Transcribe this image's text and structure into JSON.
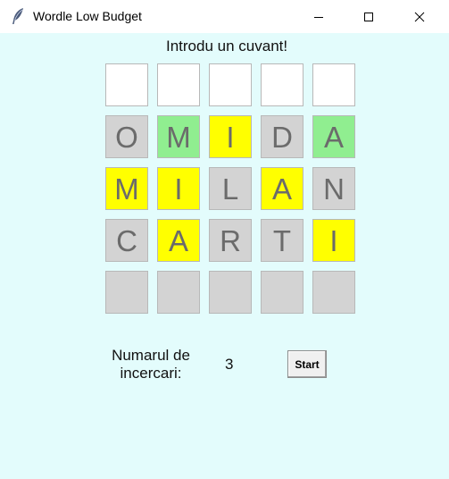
{
  "window": {
    "title": "Wordle Low Budget",
    "icon": "feather-icon",
    "controls": [
      "minimize-icon",
      "maximize-icon",
      "close-icon"
    ]
  },
  "prompt": "Introdu un cuvant!",
  "board": {
    "colors": {
      "empty": "#ffffff",
      "absent": "#d3d3d3",
      "present": "#ffff00",
      "correct": "#90ee90"
    },
    "rows": [
      [
        {
          "letter": "",
          "state": "empty"
        },
        {
          "letter": "",
          "state": "empty"
        },
        {
          "letter": "",
          "state": "empty"
        },
        {
          "letter": "",
          "state": "empty"
        },
        {
          "letter": "",
          "state": "empty"
        }
      ],
      [
        {
          "letter": "O",
          "state": "absent"
        },
        {
          "letter": "M",
          "state": "correct"
        },
        {
          "letter": "I",
          "state": "present"
        },
        {
          "letter": "D",
          "state": "absent"
        },
        {
          "letter": "A",
          "state": "correct"
        }
      ],
      [
        {
          "letter": "M",
          "state": "present"
        },
        {
          "letter": "I",
          "state": "present"
        },
        {
          "letter": "L",
          "state": "absent"
        },
        {
          "letter": "A",
          "state": "present"
        },
        {
          "letter": "N",
          "state": "absent"
        }
      ],
      [
        {
          "letter": "C",
          "state": "absent"
        },
        {
          "letter": "A",
          "state": "present"
        },
        {
          "letter": "R",
          "state": "absent"
        },
        {
          "letter": "T",
          "state": "absent"
        },
        {
          "letter": "I",
          "state": "present"
        }
      ],
      [
        {
          "letter": "",
          "state": "absent"
        },
        {
          "letter": "",
          "state": "absent"
        },
        {
          "letter": "",
          "state": "absent"
        },
        {
          "letter": "",
          "state": "absent"
        },
        {
          "letter": "",
          "state": "absent"
        }
      ]
    ]
  },
  "attempts": {
    "label": "Numarul de\nincercari:",
    "value": "3"
  },
  "start_button": {
    "label": "Start"
  }
}
